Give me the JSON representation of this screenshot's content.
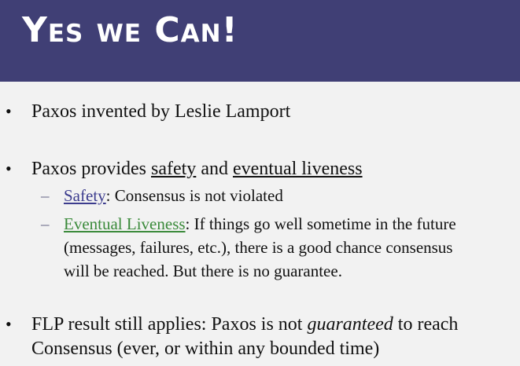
{
  "title": {
    "text": "Yes we Can!",
    "background_color": "#403f75",
    "text_color": "#ffffff"
  },
  "bullets": [
    {
      "marker": "•",
      "text": "Paxos invented by Leslie Lamport"
    },
    {
      "marker": "•",
      "prefix": "Paxos provides ",
      "term1": "safety",
      "middle": " and ",
      "term2": "eventual liveness",
      "subitems": [
        {
          "marker": "–",
          "link_text": "Safety",
          "link_color": "#3c3c8e",
          "rest": ": Consensus is not violated"
        },
        {
          "marker": "–",
          "link_text": "Eventual Liveness",
          "link_color": "#3a8a3a",
          "rest_line1": ": If things go well sometime in the future",
          "line2": "(messages, failures, etc.), there is a good chance consensus",
          "line3": "will be reached. But there is no guarantee."
        }
      ]
    },
    {
      "marker": "•",
      "prefix": "FLP result still applies: Paxos is not ",
      "emphasis": "guaranteed",
      "suffix": " to reach",
      "line2": "Consensus (ever, or within any bounded time)"
    }
  ]
}
